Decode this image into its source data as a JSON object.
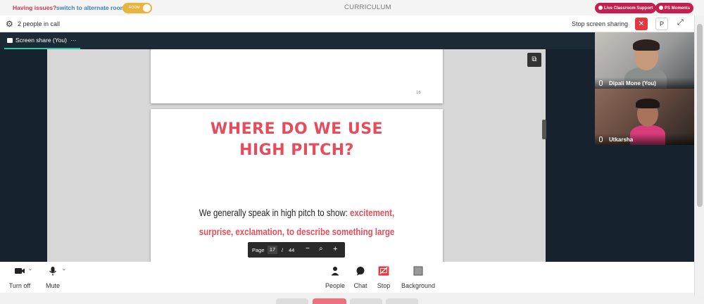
{
  "topbar": {
    "issue_text": "Having issues?",
    "switch_text": "switch to alternate room",
    "toggle_label": "ROOM",
    "title": "CURRICULUM",
    "support_button": "Live Classroom Support",
    "moments_button": "PS Moments"
  },
  "callbar": {
    "people_count": "2 people in call",
    "stop_sharing": "Stop screen sharing",
    "p_button": "P"
  },
  "stage": {
    "tab_label": "Screen share (You)",
    "tab_more": "···",
    "page_number": "16",
    "slide_title_line1": "WHERE DO WE USE",
    "slide_title_line2": "HIGH PITCH?",
    "slide_body_plain": "We generally speak in high pitch to show: ",
    "slide_body_highlight1": "excitement,",
    "slide_body_highlight2": "surprise, exclamation, to describe something large",
    "pager": {
      "label": "Page",
      "current": "17",
      "separator": "/",
      "total": "44"
    }
  },
  "participants": [
    {
      "name": "Dipali Mone (You)"
    },
    {
      "name": "Utkarsha"
    }
  ],
  "toolbar": {
    "camera": "Turn off",
    "mic": "Mute",
    "people": "People",
    "chat": "Chat",
    "stop": "Stop",
    "background": "Background"
  },
  "colors": {
    "accent_red": "#e54c5c",
    "brand_pink": "#c41d4e",
    "stage_dark": "#16232e",
    "tab_underline": "#2ec8a8"
  }
}
